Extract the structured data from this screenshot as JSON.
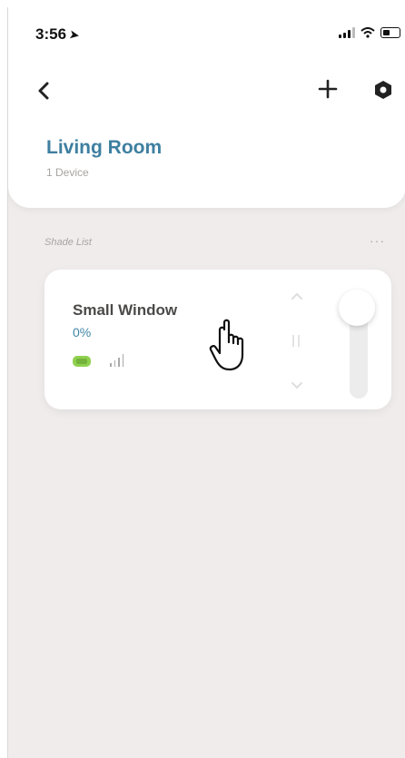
{
  "status_bar": {
    "time": "3:56",
    "location_icon": "location-arrow-icon",
    "signal_icon": "cellular-signal-icon",
    "wifi_icon": "wifi-icon",
    "battery_icon": "battery-icon"
  },
  "header": {
    "back_icon": "chevron-left-icon",
    "add_icon": "plus-icon",
    "settings_icon": "settings-hexagon-icon"
  },
  "room": {
    "title": "Living Room",
    "device_count": "1 Device"
  },
  "shade_list": {
    "section_title": "Shade List",
    "more_label": "···",
    "items": [
      {
        "name": "Small Window",
        "position": "0%",
        "position_value": 0,
        "battery_icon": "battery-icon",
        "battery_color": "#8fd14f",
        "signal_icon": "signal-strength-icon"
      }
    ]
  },
  "colors": {
    "accent": "#3e7fa0",
    "background": "#efeceb",
    "card": "#ffffff"
  }
}
